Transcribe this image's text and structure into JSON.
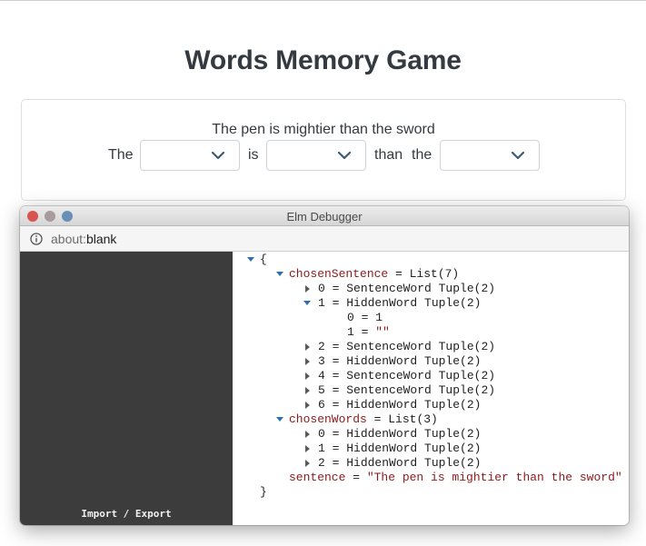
{
  "page": {
    "title": "Words Memory Game"
  },
  "game": {
    "sentence": "The pen is mightier than the sword",
    "words": [
      "The",
      "is",
      "than",
      "the"
    ],
    "selects": [
      {
        "selected": ""
      },
      {
        "selected": ""
      },
      {
        "selected": ""
      }
    ]
  },
  "debugger": {
    "window_title": "Elm Debugger",
    "address": {
      "scheme": "about:",
      "host": "blank"
    },
    "sidebar": {
      "import_export": "Import / Export"
    },
    "model": {
      "open_brace": "{",
      "close_brace": "}",
      "chosenSentence": {
        "key": "chosenSentence",
        "value": "List(7)",
        "items": [
          {
            "index": "0",
            "value": "SentenceWord Tuple(2)"
          },
          {
            "index": "1",
            "value": "HiddenWord Tuple(2)",
            "expanded": true,
            "children": [
              {
                "index": "0",
                "value": "1"
              },
              {
                "index": "1",
                "value": "\"\""
              }
            ]
          },
          {
            "index": "2",
            "value": "SentenceWord Tuple(2)"
          },
          {
            "index": "3",
            "value": "HiddenWord Tuple(2)"
          },
          {
            "index": "4",
            "value": "SentenceWord Tuple(2)"
          },
          {
            "index": "5",
            "value": "SentenceWord Tuple(2)"
          },
          {
            "index": "6",
            "value": "HiddenWord Tuple(2)"
          }
        ]
      },
      "chosenWords": {
        "key": "chosenWords",
        "value": "List(3)",
        "items": [
          {
            "index": "0",
            "value": "HiddenWord Tuple(2)"
          },
          {
            "index": "1",
            "value": "HiddenWord Tuple(2)"
          },
          {
            "index": "2",
            "value": "HiddenWord Tuple(2)"
          }
        ]
      },
      "sentence": {
        "key": "sentence",
        "value": "\"The pen is mightier than the sword\""
      }
    }
  },
  "colors": {
    "sidebar": "#3c3c3c",
    "key_red": "#8b1a1a",
    "toggle_blue": "#2c6fb0",
    "close": "#d9534f",
    "minimize": "#a89b9b",
    "maximize": "#6a8fb6"
  },
  "icons": [
    "info-icon",
    "chevron-down-icon",
    "triangle-down-icon",
    "triangle-right-icon"
  ]
}
